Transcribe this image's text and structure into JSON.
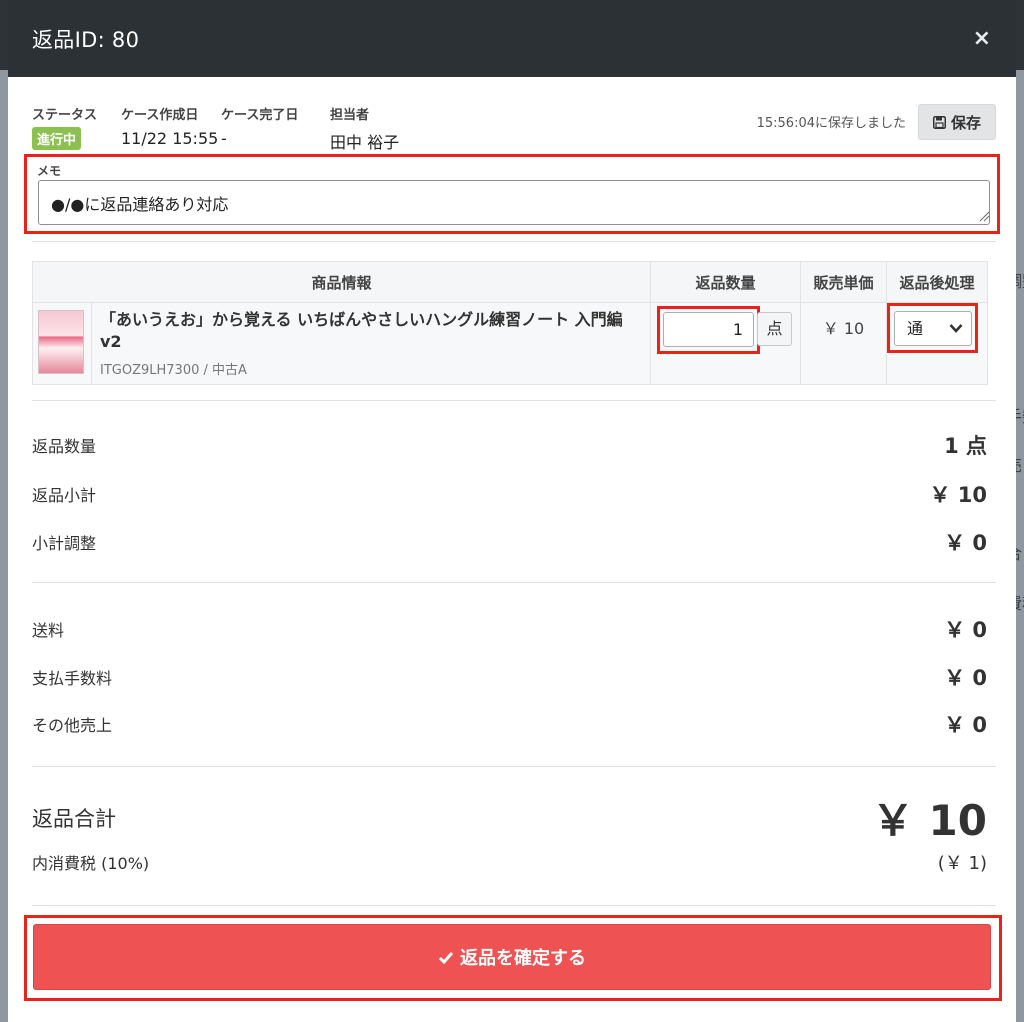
{
  "backdrop": {
    "text_1": "調整",
    "text_2": "手数",
    "text_3": "売",
    "text_4": "合",
    "text_5": "費税"
  },
  "modal": {
    "title": "返品ID: 80",
    "close_symbol": "×"
  },
  "meta": {
    "status_label": "ステータス",
    "status_value": "進行中",
    "created_label": "ケース作成日",
    "created_value": "11/22 15:55",
    "completed_label": "ケース完了日",
    "completed_value": "-",
    "assignee_label": "担当者",
    "assignee_value": "田中 裕子",
    "saved_text": "15:56:04に保存しました",
    "save_label": "保存"
  },
  "memo": {
    "label": "メモ",
    "value": "●/●に返品連絡あり対応"
  },
  "table": {
    "headers": [
      "商品情報",
      "返品数量",
      "販売単価",
      "返品後処理"
    ],
    "rows": [
      {
        "product_name": "「あいうえお」から覚える いちばんやさしいハングル練習ノート 入門編v2",
        "sku": "ITGOZ9LH7300 / 中古A",
        "quantity": "1",
        "unit": "点",
        "price": "￥ 10",
        "after_process": "通"
      }
    ]
  },
  "summary": {
    "return_qty_label": "返品数量",
    "return_qty_value": "1 点",
    "subtotal_label": "返品小計",
    "subtotal_value": "￥ 10",
    "adjust_label": "小計調整",
    "adjust_value": "￥ 0",
    "shipping_label": "送料",
    "shipping_value": "￥ 0",
    "fee_label": "支払手数料",
    "fee_value": "￥ 0",
    "other_label": "その他売上",
    "other_value": "￥ 0",
    "total_label": "返品合計",
    "total_value": "￥ 10",
    "tax_label": "内消費税 (10%)",
    "tax_value": "(￥ 1)"
  },
  "confirm": {
    "label": "返品を確定する"
  },
  "colors": {
    "accent_red": "#ee5253",
    "highlight": "#e8231a",
    "status_green": "#8cc152",
    "header_dark": "#2c3136"
  }
}
